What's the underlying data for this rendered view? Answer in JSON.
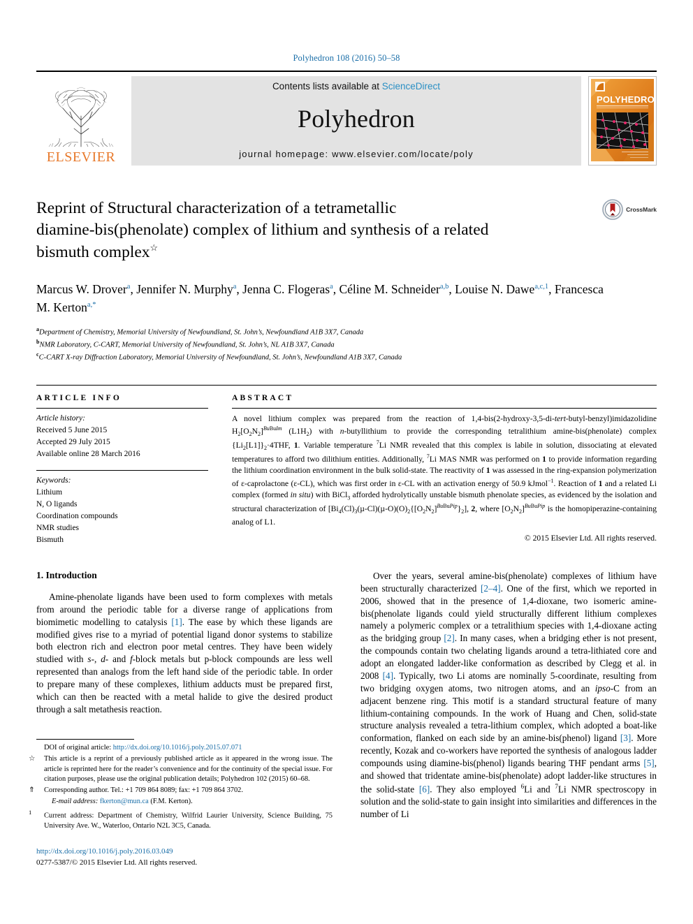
{
  "running_head": "Polyhedron 108 (2016) 50–58",
  "banner": {
    "publisher_name": "ELSEVIER",
    "contents_prefix": "Contents lists available at ",
    "contents_link": "ScienceDirect",
    "journal_name": "Polyhedron",
    "homepage_label": "journal homepage: www.elsevier.com/locate/poly",
    "cover_title": "POLYHEDRON",
    "cover_subtitle": "THE INTERNATIONAL JOURNAL FOR INORGANIC AND ORGANOMETALLIC CHEMISTRY"
  },
  "title": {
    "line1": "Reprint of Structural characterization of a tetrametallic",
    "line2": "diamine-bis(phenolate) complex of lithium and synthesis of a related",
    "line3": "bismuth complex",
    "star": "☆",
    "crossmark_label": "CrossMark"
  },
  "authors": [
    {
      "name": "Marcus W. Drover",
      "sup": "a",
      "sep": ", "
    },
    {
      "name": "Jennifer N. Murphy",
      "sup": "a",
      "sep": ", "
    },
    {
      "name": "Jenna C. Flogeras",
      "sup": "a",
      "sep": ", "
    },
    {
      "name": "Céline M. Schneider",
      "sup": "a,b",
      "sep": ", "
    },
    {
      "name": "Louise N. Dawe",
      "sup": "a,c,1",
      "sep": ", "
    },
    {
      "name": "Francesca M. Kerton",
      "sup": "a,*",
      "sep": ""
    }
  ],
  "affiliations": [
    {
      "marker": "a",
      "text": "Department of Chemistry, Memorial University of Newfoundland, St. John’s, Newfoundland A1B 3X7, Canada"
    },
    {
      "marker": "b",
      "text": "NMR Laboratory, C-CART, Memorial University of Newfoundland, St. John’s, NL A1B 3X7, Canada"
    },
    {
      "marker": "c",
      "text": "C-CART X-ray Diffraction Laboratory, Memorial University of Newfoundland, St. John’s, Newfoundland A1B 3X7, Canada"
    }
  ],
  "article_info": {
    "heading": "ARTICLE INFO",
    "history_label": "Article history:",
    "history": [
      "Received 5 June 2015",
      "Accepted 29 July 2015",
      "Available online 28 March 2016"
    ],
    "keywords_label": "Keywords:",
    "keywords": [
      "Lithium",
      "N, O ligands",
      "Coordination compounds",
      "NMR studies",
      "Bismuth"
    ]
  },
  "abstract": {
    "heading": "ABSTRACT",
    "copyright": "© 2015 Elsevier Ltd. All rights reserved."
  },
  "sections": {
    "intro_heading": "1. Introduction"
  },
  "footnotes": {
    "doi_orig_label": "DOI of original article: ",
    "doi_orig_link": "http://dx.doi.org/10.1016/j.poly.2015.07.071",
    "star_marker": "☆",
    "star_text": "This article is a reprint of a previously published article as it appeared in the wrong issue. The article is reprinted here for the reader’s convenience and for the continuity of the special issue. For citation purposes, please use the original publication details; Polyhedron 102 (2015) 60–68.",
    "corr_marker": "⇑",
    "corr_text": "Corresponding author. Tel.: +1 709 864 8089; fax: +1 709 864 3702.",
    "email_label": "E-mail address:",
    "email_link": "fkerton@mun.ca",
    "email_suffix": "(F.M. Kerton).",
    "current_marker": "1",
    "current_text": "Current address: Department of Chemistry, Wilfrid Laurier University, Science Building, 75 University Ave. W., Waterloo, Ontario N2L 3C5, Canada."
  },
  "bottom": {
    "doi_link": "http://dx.doi.org/10.1016/j.poly.2016.03.049",
    "issn_line": "0277-5387/© 2015 Elsevier Ltd. All rights reserved."
  },
  "colors": {
    "link_blue": "#1a6ea8",
    "elsevier_orange": "#E8792B",
    "banner_grey": "#e3e3e3"
  }
}
